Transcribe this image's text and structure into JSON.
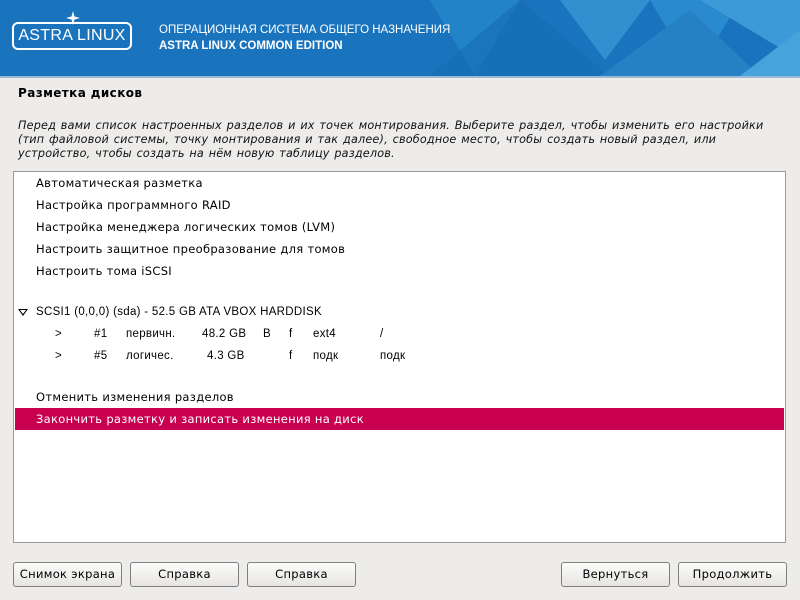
{
  "header": {
    "logo_text": "ASTRA LINUX",
    "os_title": "ОПЕРАЦИОННАЯ СИСТЕМА ОБЩЕГО НАЗНАЧЕНИЯ",
    "os_subtitle": "ASTRA LINUX COMMON EDITION",
    "banner_color": "#1a74bd"
  },
  "page": {
    "title": "Разметка дисков",
    "description": "Перед вами список настроенных разделов и их точек монтирования. Выберите раздел, чтобы изменить его настройки (тип файловой системы, точку монтирования и так далее), свободное место, чтобы создать новый раздел, или устройство, чтобы создать на нём новую таблицу разделов."
  },
  "list": {
    "items": [
      {
        "label": "Автоматическая разметка"
      },
      {
        "label": "Настройка программного RAID"
      },
      {
        "label": "Настройка менеджера логических томов (LVM)"
      },
      {
        "label": "Настроить защитное преобразование для томов"
      },
      {
        "label": "Настроить тома iSCSI"
      }
    ],
    "disk": {
      "label": "SCSI1 (0,0,0) (sda) - 52.5 GB ATA VBOX HARDDISK",
      "partitions": [
        {
          "marker": ">",
          "num": "#1",
          "type": "первичн.",
          "size": "48.2 GB",
          "boot": "B",
          "format": "f",
          "fs": "ext4",
          "mount": "/"
        },
        {
          "marker": ">",
          "num": "#5",
          "type": "логичес.",
          "size": "4.3 GB",
          "boot": "",
          "format": "f",
          "fs": "подк",
          "mount": "подк"
        }
      ]
    },
    "undo_label": "Отменить изменения разделов",
    "finish_label": "Закончить разметку и записать изменения на диск",
    "selected_color": "#c8004f"
  },
  "buttons": {
    "screenshot": "Снимок экрана",
    "help1": "Справка",
    "help2": "Справка",
    "back": "Вернуться",
    "continue": "Продолжить"
  }
}
